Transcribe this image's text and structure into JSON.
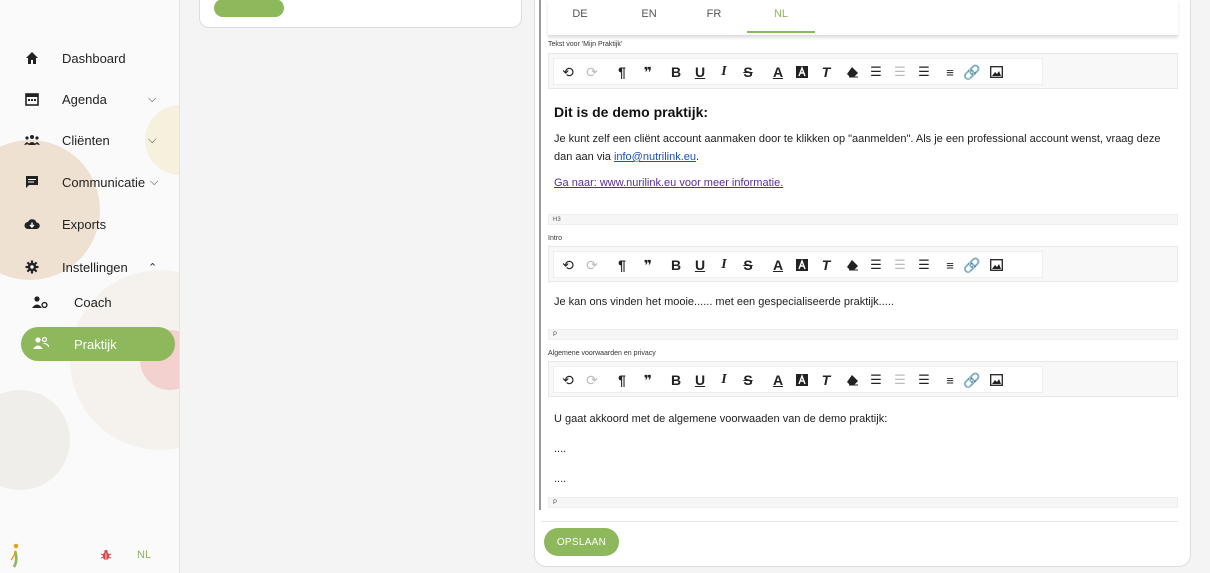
{
  "sidebar": {
    "items": [
      {
        "label": "Dashboard",
        "icon": "home-icon"
      },
      {
        "label": "Agenda",
        "icon": "calendar-icon"
      },
      {
        "label": "Cliënten",
        "icon": "people-icon"
      },
      {
        "label": "Communicatie",
        "icon": "chat-icon"
      },
      {
        "label": "Exports",
        "icon": "cloud-download-icon"
      },
      {
        "label": "Instellingen",
        "icon": "gear-icon"
      },
      {
        "label": "Coach",
        "icon": "user-gear-icon"
      },
      {
        "label": "Praktijk",
        "icon": "users-icon"
      }
    ],
    "footer_lang": "NL",
    "accent": "#8db85c"
  },
  "tabs": [
    "DE",
    "EN",
    "FR",
    "NL"
  ],
  "active_tab": "NL",
  "fields": {
    "mijn_praktijk": {
      "label": "Tekst voor 'Mijn Praktijk'",
      "heading": "Dit is de demo praktijk:",
      "para_start": "Je kunt zelf een cliënt account aanmaken door te klikken op \"aanmelden\". Als je een professional account wenst, vraag deze dan aan via ",
      "email": "info@nutrilink.eu",
      "para_end": ".",
      "link": "Ga naar: www.nurilink.eu voor meer informatie.",
      "status": "H3"
    },
    "intro": {
      "label": "Intro",
      "text": "Je kan ons vinden het mooie...... met een gespecialiseerde praktijk.....",
      "status": "P"
    },
    "voorwaarden": {
      "label": "Algemene voorwaarden en privacy",
      "line1": "U gaat akkoord met de algemene voorwaaden van de demo praktijk:",
      "line2": "....",
      "line3": "....",
      "status": "P"
    }
  },
  "save_label": "OPSLAAN"
}
